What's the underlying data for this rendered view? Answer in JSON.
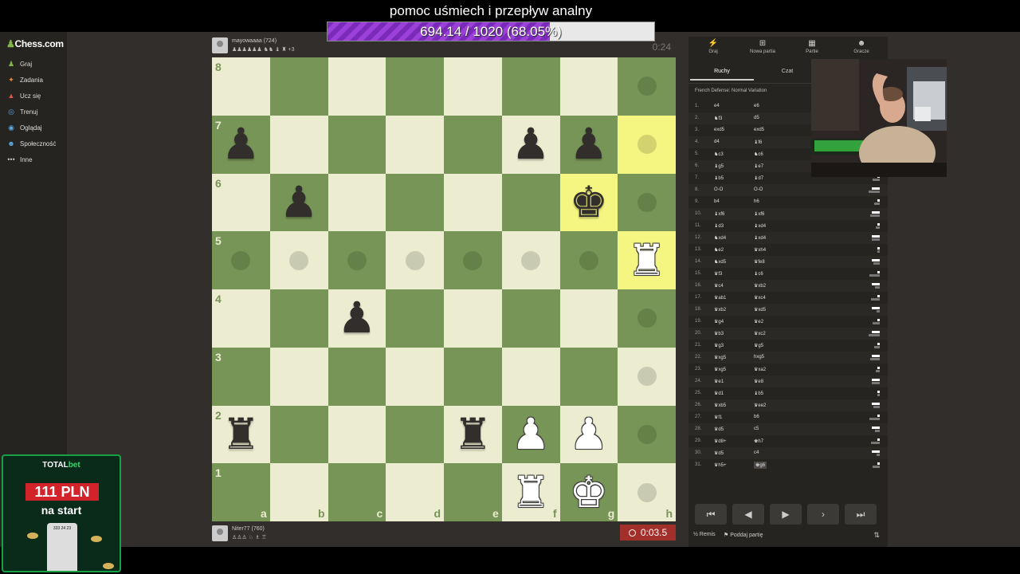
{
  "overlay": {
    "title": "pomoc uśmiech i przepływ analny",
    "goal_text": "694.14 / 1020 (68.05%)",
    "goal_fraction": 0.6805
  },
  "sidebar": {
    "logo": "Chess.com",
    "items": [
      {
        "label": "Graj",
        "icon": "pawn-icon"
      },
      {
        "label": "Zadania",
        "icon": "puzzle-icon"
      },
      {
        "label": "Ucz się",
        "icon": "graduation-icon"
      },
      {
        "label": "Trenuj",
        "icon": "target-icon"
      },
      {
        "label": "Oglądaj",
        "icon": "binoculars-icon"
      },
      {
        "label": "Społeczność",
        "icon": "people-icon"
      },
      {
        "label": "Inne",
        "icon": "more-icon"
      }
    ]
  },
  "top_player": {
    "name": "mayowaaaa (724)",
    "material": "+3",
    "clock": "0:24"
  },
  "bottom_player": {
    "name": "Niter77 (760)",
    "clock": "0:03.5"
  },
  "board": {
    "files": [
      "a",
      "b",
      "c",
      "d",
      "e",
      "f",
      "g",
      "h"
    ],
    "ranks": [
      "8",
      "7",
      "6",
      "5",
      "4",
      "3",
      "2",
      "1"
    ],
    "highlights": [
      "h7",
      "h5",
      "g6"
    ],
    "dots": [
      "h8",
      "h7",
      "h6",
      "a5",
      "b5",
      "c5",
      "d5",
      "e5",
      "f5",
      "g5",
      "h4",
      "h3",
      "h2",
      "h1"
    ],
    "pieces": [
      {
        "sq": "a7",
        "glyph": "♟",
        "color": "black"
      },
      {
        "sq": "f7",
        "glyph": "♟",
        "color": "black"
      },
      {
        "sq": "g7",
        "glyph": "♟",
        "color": "black"
      },
      {
        "sq": "b6",
        "glyph": "♟",
        "color": "black"
      },
      {
        "sq": "g6",
        "glyph": "♚",
        "color": "black"
      },
      {
        "sq": "h5",
        "glyph": "♜",
        "color": "white"
      },
      {
        "sq": "c4",
        "glyph": "♟",
        "color": "black"
      },
      {
        "sq": "a2",
        "glyph": "♜",
        "color": "black"
      },
      {
        "sq": "e2",
        "glyph": "♜",
        "color": "black"
      },
      {
        "sq": "f2",
        "glyph": "♟",
        "color": "white"
      },
      {
        "sq": "g2",
        "glyph": "♟",
        "color": "white"
      },
      {
        "sq": "f1",
        "glyph": "♜",
        "color": "white"
      },
      {
        "sq": "g1",
        "glyph": "♚",
        "color": "white"
      }
    ]
  },
  "panel": {
    "tabs": [
      {
        "label": "Graj",
        "icon": "lightning-icon"
      },
      {
        "label": "Nowa partia",
        "icon": "plus-icon"
      },
      {
        "label": "Partie",
        "icon": "grid-icon"
      },
      {
        "label": "Gracze",
        "icon": "people-icon"
      }
    ],
    "subtabs": [
      "Ruchy",
      "Czat"
    ],
    "opening": "French Defense: Normal Variation",
    "moves": [
      [
        "1.",
        "e4",
        "e6"
      ],
      [
        "2.",
        "♞f3",
        "d5"
      ],
      [
        "3.",
        "exd5",
        "exd5"
      ],
      [
        "4.",
        "d4",
        "♝f6"
      ],
      [
        "5.",
        "♞c3",
        "♞c6"
      ],
      [
        "6.",
        "♝g5",
        "♝e7"
      ],
      [
        "7.",
        "♝b5",
        "♝d7"
      ],
      [
        "8.",
        "O-O",
        "O-O"
      ],
      [
        "9.",
        "b4",
        "h6"
      ],
      [
        "10.",
        "♝xf6",
        "♝xf6"
      ],
      [
        "11.",
        "♝d3",
        "♝xd4"
      ],
      [
        "12.",
        "♞xd4",
        "♝xd4"
      ],
      [
        "13.",
        "♞e2",
        "♛xh4"
      ],
      [
        "14.",
        "♞xd5",
        "♛fe8"
      ],
      [
        "15.",
        "♛f3",
        "♝c6"
      ],
      [
        "16.",
        "♛c4",
        "♛xb2"
      ],
      [
        "17.",
        "♛ab1",
        "♛xc4"
      ],
      [
        "18.",
        "♛xb2",
        "♛xd5"
      ],
      [
        "19.",
        "♛g4",
        "♛e2"
      ],
      [
        "20.",
        "♛b3",
        "♛xc2"
      ],
      [
        "21.",
        "♛g3",
        "♛g5"
      ],
      [
        "22.",
        "♛xg5",
        "hxg5"
      ],
      [
        "23.",
        "♛xg5",
        "♛xa2"
      ],
      [
        "24.",
        "♛e1",
        "♛e8"
      ],
      [
        "25.",
        "♛d1",
        "♝b5"
      ],
      [
        "26.",
        "♛xb5",
        "♛ee2"
      ],
      [
        "27.",
        "♛f1",
        "b6"
      ],
      [
        "28.",
        "♛d5",
        "c5"
      ],
      [
        "29.",
        "♛d8+",
        "♚h7"
      ],
      [
        "30.",
        "♛d5",
        "c4"
      ],
      [
        "31.",
        "♛h5+",
        "♚g6"
      ]
    ],
    "controls": [
      "first-icon",
      "prev-icon",
      "play-icon",
      "next-icon",
      "last-icon"
    ],
    "draw_label": "Remis",
    "resign_label": "Poddaj partię"
  },
  "ad": {
    "brand_a": "TOTAL",
    "brand_b": "bet",
    "amount": "111 PLN",
    "sub": "na start",
    "phone_text": "333 24 23"
  }
}
